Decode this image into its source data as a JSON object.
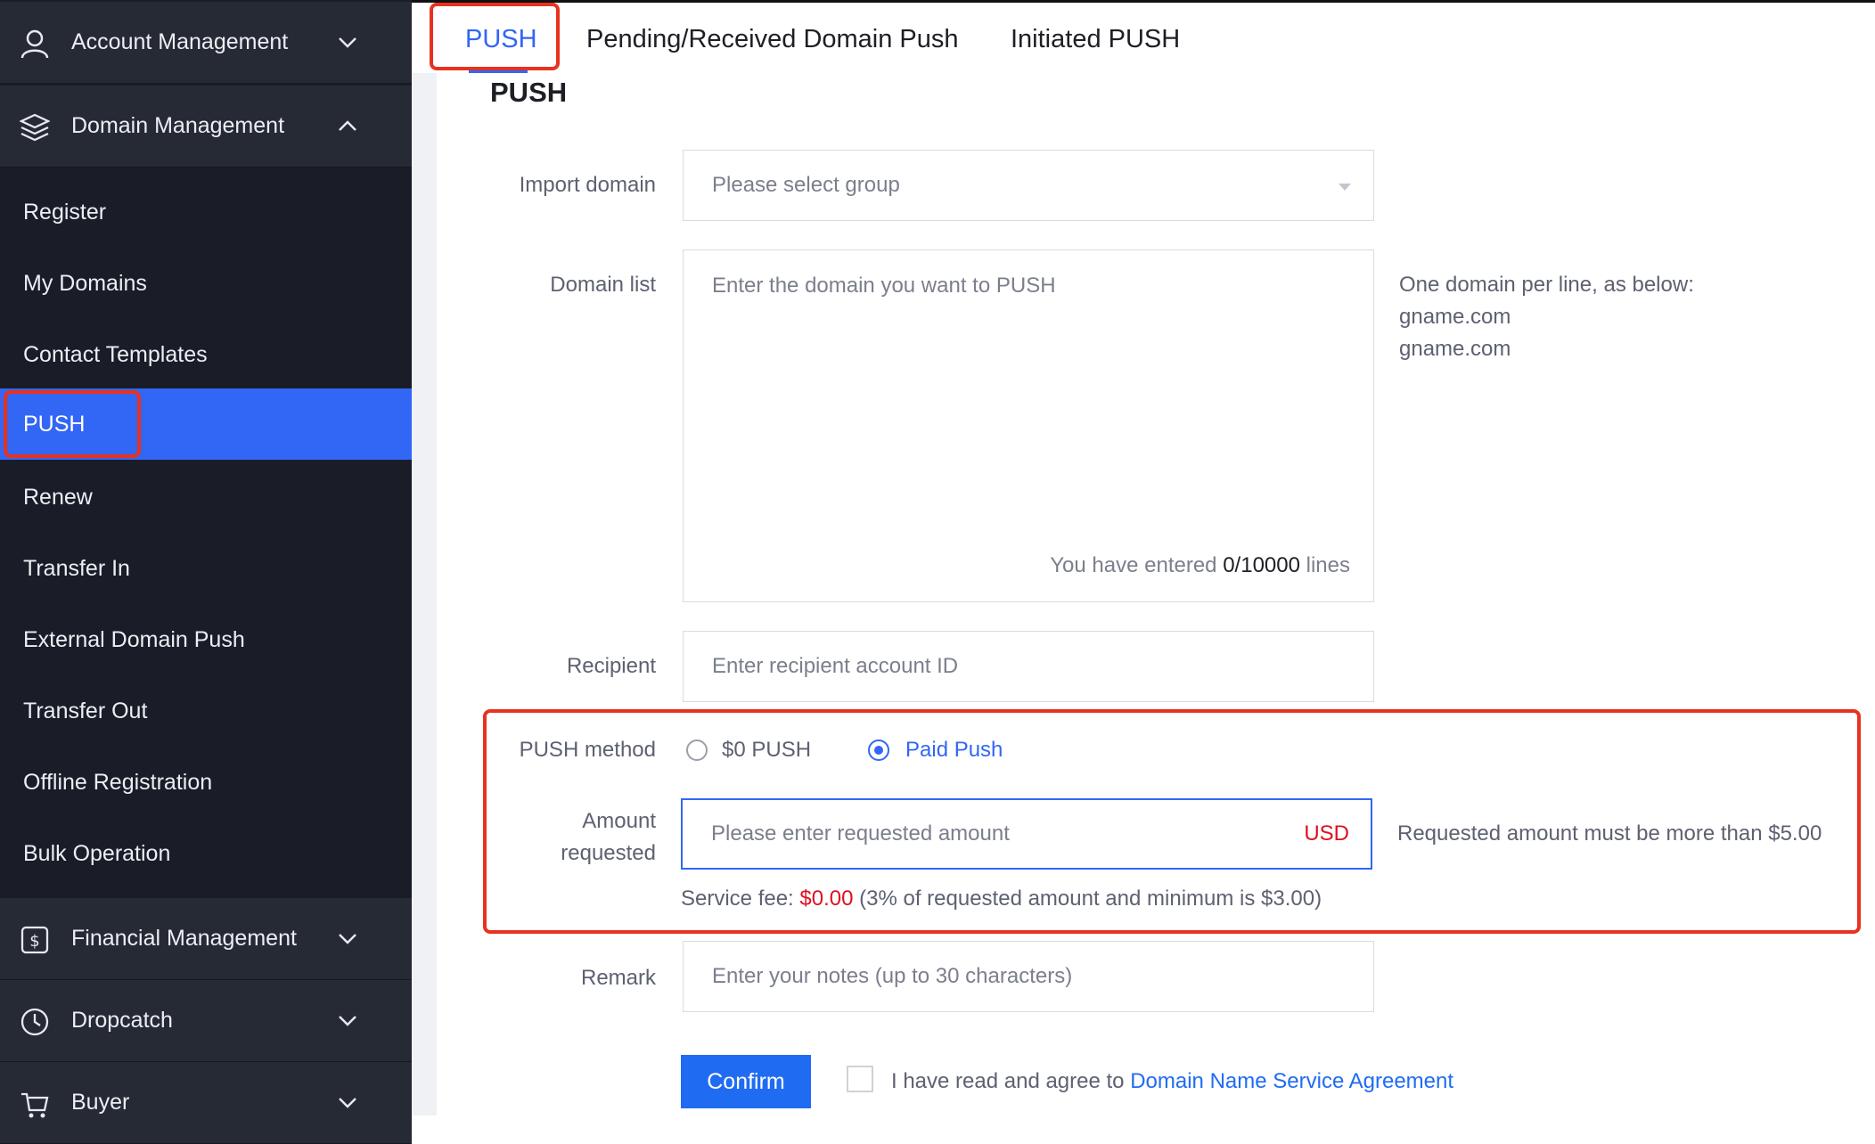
{
  "sidebar": {
    "groups": {
      "account": "Account Management",
      "domain": "Domain Management",
      "financial": "Financial Management",
      "dropcatch": "Dropcatch",
      "buyer": "Buyer"
    },
    "items": [
      "Register",
      "My Domains",
      "Contact Templates",
      "PUSH",
      "Renew",
      "Transfer In",
      "External Domain Push",
      "Transfer Out",
      "Offline Registration",
      "Bulk Operation"
    ],
    "active_item": "PUSH"
  },
  "tabs": [
    "PUSH",
    "Pending/Received Domain Push",
    "Initiated PUSH"
  ],
  "form": {
    "title": "PUSH",
    "import_domain": {
      "label": "Import domain",
      "placeholder": "Please select group"
    },
    "domain_list": {
      "label": "Domain list",
      "placeholder": "Enter the domain you want to PUSH",
      "counter_prefix": "You have entered",
      "counter_value": "0/10000",
      "counter_suffix": "lines",
      "hint_lines": [
        "One domain per line, as below:",
        "gname.com",
        "gname.com"
      ]
    },
    "recipient": {
      "label": "Recipient",
      "placeholder": "Enter recipient account ID"
    },
    "push_method": {
      "label": "PUSH method",
      "options": [
        "$0 PUSH",
        "Paid Push"
      ],
      "selected": "Paid Push"
    },
    "amount": {
      "label_line1": "Amount",
      "label_line2": "requested",
      "placeholder": "Please enter requested amount",
      "currency": "USD",
      "hint": "Requested amount must be more than $5.00",
      "fee_prefix": "Service fee:",
      "fee_value": "$0.00",
      "fee_suffix": "(3% of requested amount and minimum is $3.00)"
    },
    "remark": {
      "label": "Remark",
      "placeholder": "Enter your notes (up to 30 characters)"
    },
    "confirm_label": "Confirm",
    "agreement_prefix": "I have read and agree to",
    "agreement_link": "Domain Name Service Agreement"
  },
  "colors": {
    "accent": "#3266f5",
    "sidebar_bg": "#1a1d27",
    "highlight": "#e8321f",
    "fee": "#e0101f"
  }
}
